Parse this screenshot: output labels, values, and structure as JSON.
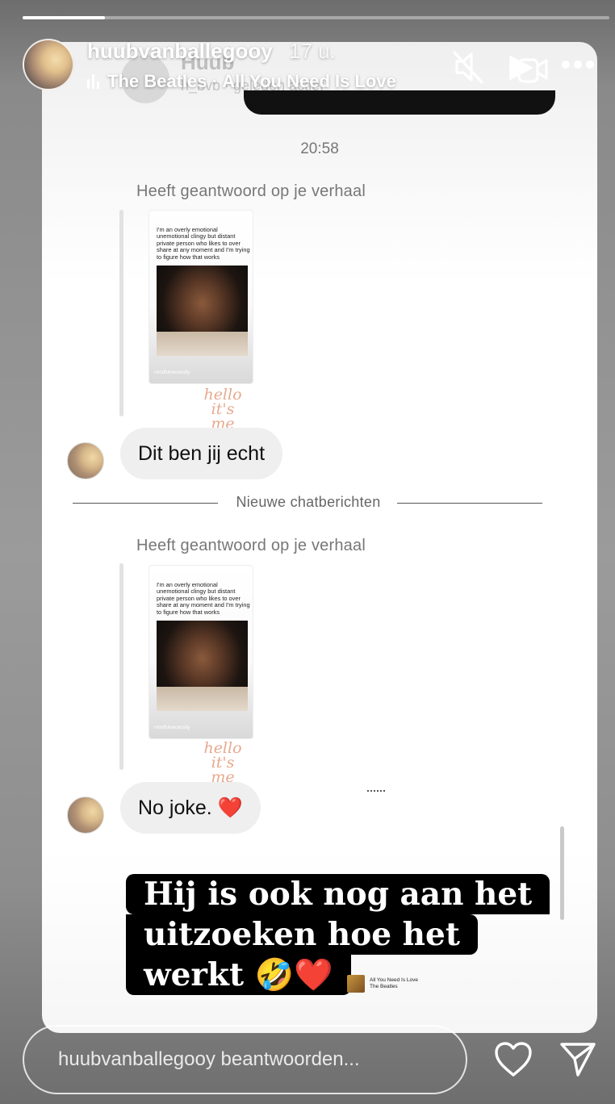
{
  "story": {
    "progress": 0.14,
    "username": "huubvanballegooy",
    "time_ago": "17 u.",
    "music": {
      "song": "The Beatles · All You Need Is Love"
    },
    "header_icons": [
      "mute-icon",
      "video-call-icon",
      "more-icon"
    ]
  },
  "chat_screenshot": {
    "ghost_header": {
      "name": "Huub",
      "status": "h_bvb · geleden actief"
    },
    "timestamp": "20:58",
    "replies": [
      {
        "label": "Heeft geantwoord op je verhaal",
        "thumb_text": "I'm an overly emotional unemotional clingy but distant private person who likes to over share at any moment and I'm trying to figure how that works",
        "thumb_source": "mindfulnecessity",
        "sticker": "hello it's me",
        "message": "Dit ben jij echt"
      },
      {
        "label": "Heeft geantwoord op je verhaal",
        "thumb_text": "I'm an overly emotional unemotional clingy but distant private person who likes to over share at any moment and I'm trying to figure how that works",
        "thumb_source": "mindfulnecessity",
        "sticker": "hello it's me",
        "message": "No joke. ❤️"
      }
    ],
    "divider": "Nieuwe chatberichten"
  },
  "caption": {
    "lines": [
      "Hij is ook nog aan het",
      "uitzoeken hoe het",
      "werkt 🤣❤️"
    ]
  },
  "music_sticker": {
    "title": "All You Need Is Love",
    "artist": "The Beatles"
  },
  "footer": {
    "reply_placeholder": "huubvanballegooy beantwoorden...",
    "icons": [
      "heart-icon",
      "send-icon"
    ]
  }
}
